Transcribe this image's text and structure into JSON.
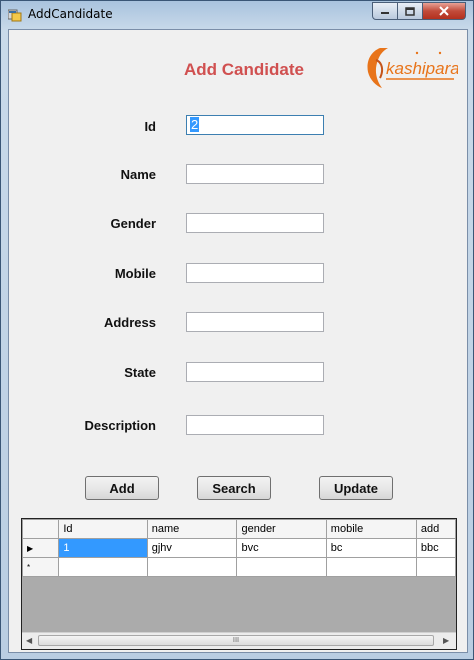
{
  "window": {
    "title": "AddCandidate"
  },
  "form": {
    "heading": "Add Candidate",
    "logo_text": "kashipara",
    "fields": [
      {
        "label": "Id",
        "value": "2"
      },
      {
        "label": "Name",
        "value": ""
      },
      {
        "label": "Gender",
        "value": ""
      },
      {
        "label": "Mobile",
        "value": ""
      },
      {
        "label": "Address",
        "value": ""
      },
      {
        "label": "State",
        "value": ""
      },
      {
        "label": "Description",
        "value": ""
      }
    ],
    "buttons": {
      "add": "Add",
      "search": "Search",
      "update": "Update"
    }
  },
  "grid": {
    "columns": [
      "Id",
      "name",
      "gender",
      "mobile",
      "add"
    ],
    "rows": [
      {
        "indicator": "▶",
        "cells": [
          "1",
          "gjhv",
          "bvc",
          "bc",
          "bbc"
        ]
      },
      {
        "indicator": "*",
        "cells": [
          "",
          "",
          "",
          "",
          ""
        ]
      }
    ],
    "scroll_grip": "III"
  },
  "colors": {
    "heading": "#d05050",
    "logo_orange": "#e8741a",
    "selection": "#3399ff"
  }
}
